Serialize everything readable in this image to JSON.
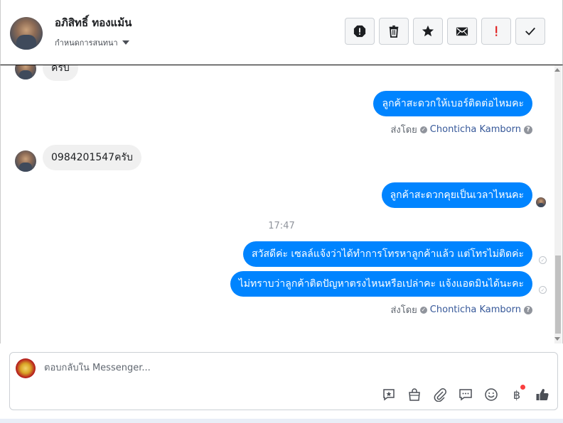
{
  "header": {
    "contact_name": "อภิสิทธิ์ ทองแม้น",
    "conversation_label": "กำหนดการสนทนา",
    "toolbar": [
      {
        "name": "spam-button",
        "icon": "alert-octagon-icon"
      },
      {
        "name": "delete-button",
        "icon": "trash-icon"
      },
      {
        "name": "star-button",
        "icon": "star-icon"
      },
      {
        "name": "mark-unread-button",
        "icon": "envelope-icon"
      },
      {
        "name": "follow-up-button",
        "icon": "exclamation-icon"
      },
      {
        "name": "done-button",
        "icon": "check-icon"
      }
    ]
  },
  "messages": {
    "partial_top": "ครับ",
    "msg1": "ลูกค้าสะดวกให้เบอร์ติดต่อไหมคะ",
    "sent_by_1": {
      "prefix": "ส่งโดย",
      "name": "Chonticha Kamborn"
    },
    "msg2": "0984201547ครับ",
    "msg3": "ลูกค้าสะดวกคุยเป็นเวลาไหนคะ",
    "timestamp": "17:47",
    "msg4": "สวัสดีค่ะ เซลล์แจ้งว่าได้ทำการโทรหาลูกค้าแล้ว แต่โทรไม่ติดค่ะ",
    "msg5": "ไม่ทราบว่าลูกค้าติดปัญหาตรงไหนหรือเปล่าคะ แจ้งแอดมินได้นะคะ",
    "sent_by_2": {
      "prefix": "ส่งโดย",
      "name": "Chonticha Kamborn"
    }
  },
  "composer": {
    "placeholder": "ตอบกลับใน Messenger...",
    "value": "",
    "icons": [
      "saved-reply-icon",
      "shopping-bag-icon",
      "paperclip-icon",
      "chat-bubbles-icon",
      "emoji-icon",
      "baht-icon",
      "thumbs-up-icon"
    ]
  },
  "colors": {
    "outgoing_bubble": "#0084ff",
    "incoming_bubble": "#f0f0f0",
    "follow_up_red": "#e02424",
    "link_blue": "#365899"
  }
}
